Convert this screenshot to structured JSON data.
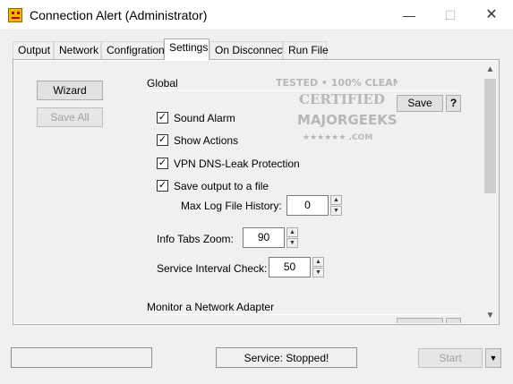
{
  "window": {
    "title": "Connection Alert (Administrator)",
    "min_glyph": "—",
    "max_glyph": "☐",
    "close_glyph": "✕"
  },
  "tabs": [
    "Output",
    "Network",
    "Configration",
    "Settings",
    "On Disconnect",
    "Run File"
  ],
  "active_tab": "Settings",
  "side_buttons": {
    "wizard": "Wizard",
    "save_all": "Save All"
  },
  "global": {
    "header": "Global",
    "save_label": "Save",
    "help_label": "?",
    "checkboxes": [
      {
        "label": "Sound Alarm",
        "checked": true
      },
      {
        "label": "Show Actions",
        "checked": true
      },
      {
        "label": "VPN DNS-Leak Protection",
        "checked": true
      },
      {
        "label": "Save output to a file",
        "checked": true
      }
    ],
    "max_log": {
      "label": "Max Log File History:",
      "value": "0"
    },
    "info_zoom": {
      "label": "Info Tabs Zoom:",
      "value": "90"
    },
    "service_interval": {
      "label": "Service Interval Check:",
      "value": "50"
    }
  },
  "monitor": {
    "header": "Monitor a Network Adapter"
  },
  "watermark": {
    "line1": "TESTED • 100% CLEAN",
    "line2": "CERTIFIED",
    "line3": "MAJORGEEKS",
    "line4": "★★★★★★ .COM"
  },
  "bottom": {
    "status": "Service: Stopped!",
    "start": "Start",
    "dropdown_glyph": "▼"
  },
  "icons": {
    "check": "✓",
    "spin_up": "▲",
    "spin_down": "▼",
    "scroll_up": "▲",
    "scroll_down": "▼"
  }
}
